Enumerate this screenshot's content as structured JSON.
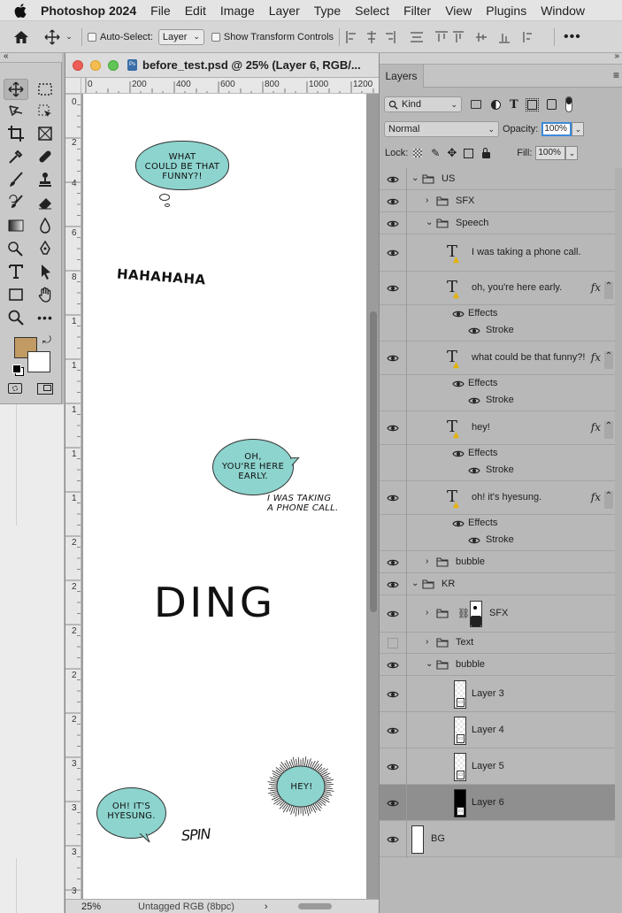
{
  "menubar": {
    "app": "Photoshop 2024",
    "items": [
      "File",
      "Edit",
      "Image",
      "Layer",
      "Type",
      "Select",
      "Filter",
      "View",
      "Plugins",
      "Window"
    ]
  },
  "options": {
    "auto_select_label": "Auto-Select:",
    "auto_select_value": "Layer",
    "show_transform_label": "Show Transform Controls"
  },
  "document": {
    "title": "before_test.psd @ 25% (Layer 6, RGB/...",
    "zoom": "25%",
    "color_profile": "Untagged RGB (8bpc)",
    "hruler": [
      "0",
      "200",
      "400",
      "600",
      "800",
      "1000",
      "1200"
    ],
    "vruler": [
      "0",
      "2",
      "4",
      "6",
      "8",
      "1",
      "1",
      "1",
      "1",
      "1",
      "2",
      "2",
      "2",
      "2",
      "2",
      "3",
      "3",
      "3",
      "3"
    ]
  },
  "artwork": {
    "bubble1": [
      "WHAT",
      "COULD BE THAT",
      "FUNNY?!"
    ],
    "hahaha": "HAHAHAHA",
    "bubble2": [
      "OH,",
      "YOU'RE HERE",
      "EARLY."
    ],
    "phone": [
      "I WAS TAKING",
      "A PHONE CALL."
    ],
    "ding": "DING",
    "hey": "HEY!",
    "bubble3": [
      "OH! IT'S",
      "HYESUNG."
    ],
    "spin": "SPIN"
  },
  "layers_panel": {
    "tab": "Layers",
    "filter_kind": "Kind",
    "blend_mode": "Normal",
    "opacity_label": "Opacity:",
    "opacity": "100%",
    "lock_label": "Lock:",
    "fill_label": "Fill:",
    "fill": "100%",
    "rows": {
      "us": "US",
      "us_sfx": "SFX",
      "speech": "Speech",
      "phone": "I was taking a phone call.",
      "early": "oh, you're here early.",
      "funny": "what could be that funny?!",
      "hey": "hey!",
      "hyesung": "oh! it's hyesung.",
      "effects": "Effects",
      "stroke": "Stroke",
      "us_bubble": "bubble",
      "kr": "KR",
      "kr_sfx": "SFX",
      "kr_text": "Text",
      "kr_bubble": "bubble",
      "layer3": "Layer 3",
      "layer4": "Layer 4",
      "layer5": "Layer 5",
      "layer6": "Layer 6",
      "bg": "BG",
      "fx": "fx"
    }
  },
  "colors": {
    "foreground": "#c29a63",
    "background": "#ffffff",
    "bubble": "#8dd4ce",
    "selected_row": "#8f8f8f"
  }
}
